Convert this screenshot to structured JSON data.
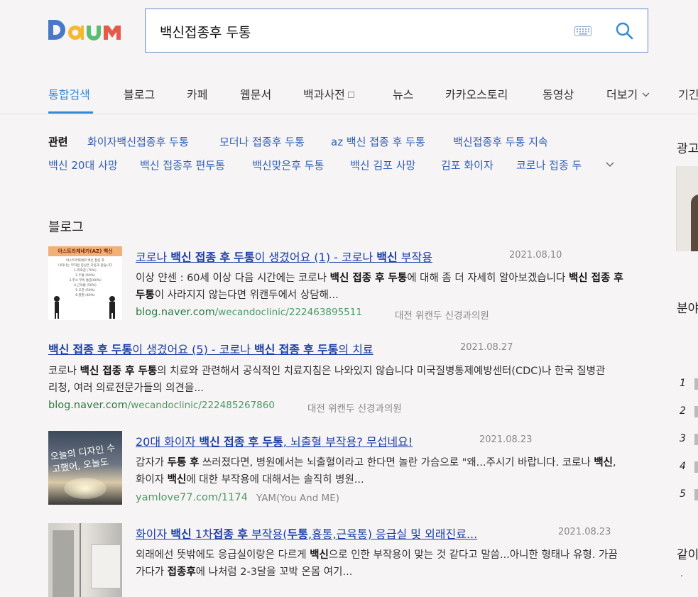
{
  "header": {
    "logo_text": "Daum",
    "search_value": "백신접종후 두통",
    "keyboard_icon": "keyboard-icon",
    "search_icon": "search-icon"
  },
  "tabs": [
    {
      "label": "통합검색",
      "active": true
    },
    {
      "label": "블로그"
    },
    {
      "label": "카페"
    },
    {
      "label": "웹문서"
    },
    {
      "label": "백과사전"
    },
    {
      "label": "뉴스"
    },
    {
      "label": "카카오스토리"
    },
    {
      "label": "동영상"
    },
    {
      "label": "더보기"
    },
    {
      "label": "기긴"
    }
  ],
  "related": {
    "label": "관련",
    "items": [
      "화이자백신접종후 두통",
      "모더나 접종후 두통",
      "az 백신 접종 후 두통",
      "백신접종후 두통 지속",
      "백신 20대 사망",
      "백신 접종후 편두통",
      "백신맞은후 두통",
      "백신 김포 사망",
      "김포 화이자",
      "코로나 접종 두"
    ]
  },
  "blog": {
    "section_title": "블로그",
    "results": [
      {
        "title_parts": [
          {
            "t": "코로나 "
          },
          {
            "t": "백신",
            "b": true
          },
          {
            "t": " "
          },
          {
            "t": "접종",
            "b": true
          },
          {
            "t": " "
          },
          {
            "t": "후",
            "b": true
          },
          {
            "t": " "
          },
          {
            "t": "두통",
            "b": true
          },
          {
            "t": "이 생겼어요 (1) - 코로나 "
          },
          {
            "t": "백신",
            "b": true
          },
          {
            "t": " 부작용"
          }
        ],
        "date": "2021.08.10",
        "desc_parts": [
          {
            "t": "이상 얀센 : 60세 이상  다음 시간에는 코로나 "
          },
          {
            "t": "백신 접종 후 두통",
            "b": true
          },
          {
            "t": "에 대해 좀 더 자세히 알아보겠습니다 "
          },
          {
            "t": "백신 접종 후 두통",
            "b": true
          },
          {
            "t": "이 사라지지 않는다면 위캔두에서 상담해..."
          }
        ],
        "url_domain": "blog.naver.com",
        "url_path": "/wecandoclinic/222463895511",
        "source": "대전 위캔두 신경과의원",
        "thumb_title": "아스트라제네카(AZ) 백신",
        "thumb_lines": [
          "아스트라제네카 백신 접종 후",
          "나타나는 부작용 증상은 다음과 같습니다",
          "1.피로감 (70%)",
          "2.두통 (60%)",
          "3.주사 부위 통증(60%)",
          "4.근육통 (50%)",
          "5.오한 (50%)",
          "6.발열 (40%)"
        ]
      },
      {
        "title_parts": [
          {
            "t": "백신",
            "b": true
          },
          {
            "t": " "
          },
          {
            "t": "접종",
            "b": true
          },
          {
            "t": " "
          },
          {
            "t": "후",
            "b": true
          },
          {
            "t": " "
          },
          {
            "t": "두통",
            "b": true
          },
          {
            "t": "이 생겼어요 (5) - 코로나 "
          },
          {
            "t": "백신",
            "b": true
          },
          {
            "t": " "
          },
          {
            "t": "접종",
            "b": true
          },
          {
            "t": " "
          },
          {
            "t": "후",
            "b": true
          },
          {
            "t": " "
          },
          {
            "t": "두통",
            "b": true
          },
          {
            "t": "의 치료"
          }
        ],
        "date": "2021.08.27",
        "desc_parts": [
          {
            "t": " 코로나 "
          },
          {
            "t": "백신 접종 후 두통",
            "b": true
          },
          {
            "t": "의 치료와 관련해서 공식적인 치료지침은 나와있지 않습니다 미국질병통제예방센터(CDC)나 한국 질병관리청, 여러 의료전문가들의 의견을..."
          }
        ],
        "url_domain": "blog.naver.com",
        "url_path": "/wecandoclinic/222485267860",
        "source": "대전 위캔두 신경과의원"
      },
      {
        "title_parts": [
          {
            "t": "20대 화이자 "
          },
          {
            "t": "백신",
            "b": true
          },
          {
            "t": " "
          },
          {
            "t": "접종",
            "b": true
          },
          {
            "t": " "
          },
          {
            "t": "후",
            "b": true
          },
          {
            "t": " "
          },
          {
            "t": "두통",
            "b": true
          },
          {
            "t": ", 뇌출혈 부작용? 무섭네요!"
          }
        ],
        "date": "2021.08.23",
        "desc_parts": [
          {
            "t": "갑자가 "
          },
          {
            "t": "두통",
            "b": true
          },
          {
            "t": " "
          },
          {
            "t": "후",
            "b": true
          },
          {
            "t": " 쓰러졌다면, 병원에서는 뇌출혈이라고 한다면 놀란 가슴으로 \"왜...주시기 바랍니다. 코로나 "
          },
          {
            "t": "백신",
            "b": true
          },
          {
            "t": ", 화이자 "
          },
          {
            "t": "백신",
            "b": true
          },
          {
            "t": "에 대한 부작용에 대해서는 솔직히 병원..."
          }
        ],
        "url_domain": "yamlove77.com",
        "url_path": "/1174",
        "source": "YAM(You And ME)",
        "thumb_text": "오늘의 디자인 수고했어, 오늘도"
      },
      {
        "title_parts": [
          {
            "t": "화이자 "
          },
          {
            "t": "백신",
            "b": true
          },
          {
            "t": " 1차"
          },
          {
            "t": "접종",
            "b": true
          },
          {
            "t": " "
          },
          {
            "t": "후",
            "b": true
          },
          {
            "t": " 부작용("
          },
          {
            "t": "두통",
            "b": true
          },
          {
            "t": ",흉통,근육통) 응급실 및 외래진료..."
          }
        ],
        "date": "2021.08.23",
        "desc_parts": [
          {
            "t": "외래에선 뜻밖에도 응급실이랑은 다르게 "
          },
          {
            "t": "백신",
            "b": true
          },
          {
            "t": "으로 인한 부작용이 맞는 것 같다고 말씀...아니한 형태나 유형.    가끔가다가 "
          },
          {
            "t": "접종후",
            "b": true
          },
          {
            "t": "에 나처럼 2-3달을 꼬박 온몸 여기..."
          }
        ]
      }
    ]
  },
  "sidebar": {
    "ad_title": "광고",
    "section2_title": "분야",
    "numbers": [
      "1",
      "2",
      "3",
      "4",
      "5"
    ],
    "section3_title": "같이",
    "bullet": "·"
  }
}
